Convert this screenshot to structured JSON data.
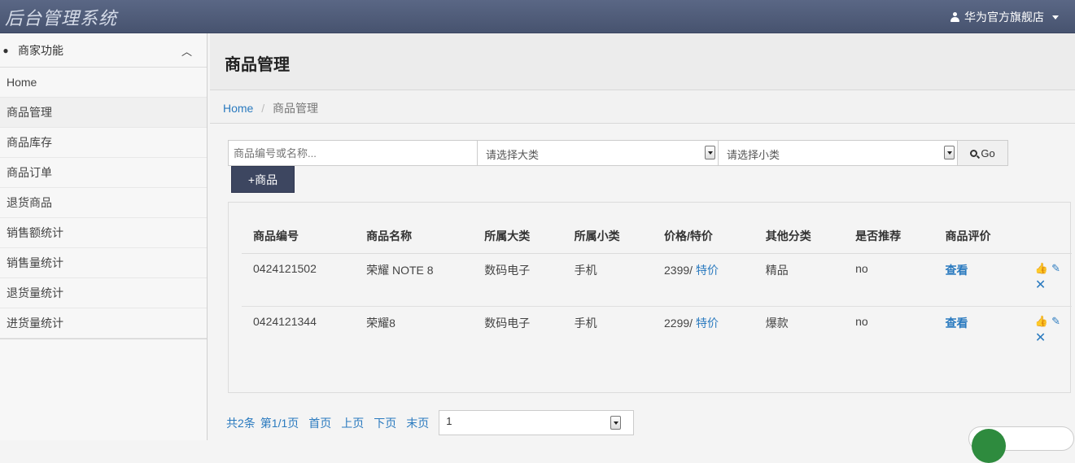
{
  "app": {
    "title": "后台管理系统"
  },
  "user": {
    "name": "华为官方旗舰店"
  },
  "sidebar": {
    "section_label": "商家功能",
    "items": [
      {
        "label": "Home"
      },
      {
        "label": "商品管理"
      },
      {
        "label": "商品库存"
      },
      {
        "label": "商品订单"
      },
      {
        "label": "退货商品"
      },
      {
        "label": "销售额统计"
      },
      {
        "label": "销售量统计"
      },
      {
        "label": "退货量统计"
      },
      {
        "label": "进货量统计"
      }
    ]
  },
  "page": {
    "title": "商品管理"
  },
  "breadcrumb": {
    "home": "Home",
    "separator": "/",
    "current": "商品管理"
  },
  "filters": {
    "search_placeholder": "商品编号或名称...",
    "category_value": "请选择大类",
    "subcategory_value": "请选择小类",
    "go_label": "Go"
  },
  "add_button": {
    "label": "+商品"
  },
  "table": {
    "headers": [
      "商品编号",
      "商品名称",
      "所属大类",
      "所属小类",
      "价格/特价",
      "其他分类",
      "是否推荐",
      "商品评价"
    ],
    "rows": [
      {
        "id": "0424121502",
        "name": "荣耀 NOTE 8",
        "category": "数码电子",
        "subcategory": "手机",
        "price": "2399/",
        "special": "特价",
        "other": "精品",
        "recommend": "no",
        "review": "查看"
      },
      {
        "id": "0424121344",
        "name": "荣耀8",
        "category": "数码电子",
        "subcategory": "手机",
        "price": "2299/",
        "special": "特价",
        "other": "爆款",
        "recommend": "no",
        "review": "查看"
      }
    ]
  },
  "pager": {
    "total": "共2条",
    "page_info": "第1/1页",
    "first": "首页",
    "prev": "上页",
    "next": "下页",
    "last": "末页",
    "selected_page": "1"
  },
  "colors": {
    "topbar": "#4f5b78",
    "link": "#2a7abf",
    "add_button": "#3d4660"
  }
}
